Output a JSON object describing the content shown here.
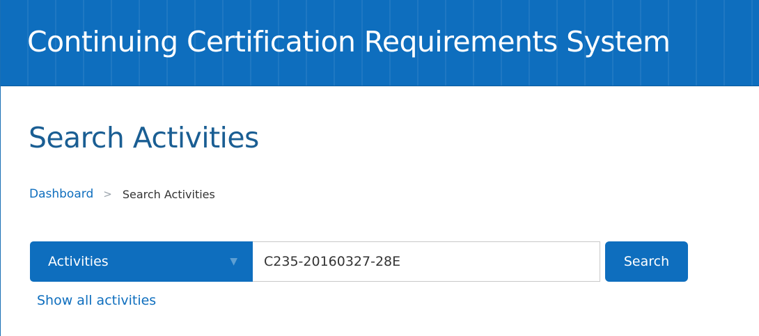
{
  "header": {
    "system_title": "Continuing Certification Requirements System"
  },
  "page": {
    "title": "Search Activities"
  },
  "breadcrumb": {
    "items": [
      "Dashboard",
      "Search Activities"
    ],
    "separator": ">"
  },
  "search": {
    "type_options_selected": "Activities",
    "caret_icon": "▼",
    "query_value": "C235-20160327-28E",
    "button_label": "Search",
    "show_all_label": "Show all activities"
  },
  "colors": {
    "brand_blue": "#0e6ebe",
    "title_blue": "#1a5e93"
  }
}
